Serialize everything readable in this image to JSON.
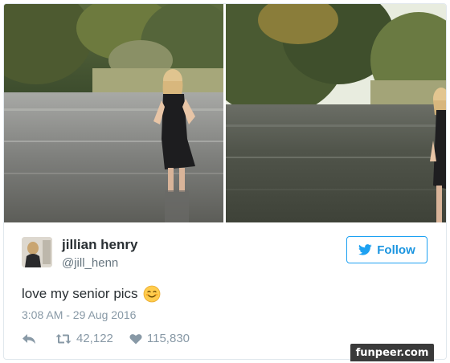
{
  "tweet": {
    "display_name": "jillian henry",
    "handle": "@jill_henn",
    "follow_label": "Follow",
    "text": "love my senior pics",
    "emoji": "smiling-face-emoji",
    "timestamp": "3:08 AM - 29 Aug 2016",
    "retweets": "42,122",
    "likes": "115,830"
  },
  "icons": {
    "follow": "twitter-bird-icon",
    "reply": "reply-icon",
    "retweet": "retweet-icon",
    "like": "heart-icon"
  },
  "colors": {
    "twitter_blue": "#1da1f2",
    "text": "#292f33",
    "muted": "#8899a6"
  },
  "watermark": "funpeer.com"
}
